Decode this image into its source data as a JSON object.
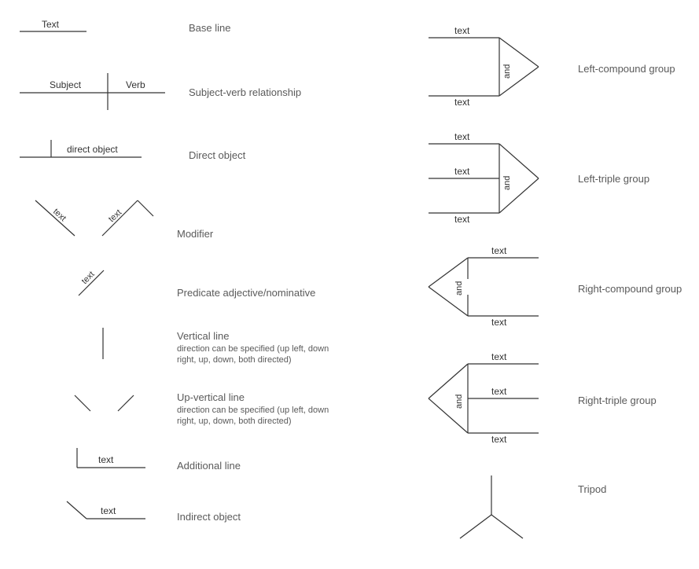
{
  "left": [
    {
      "name": "Base line",
      "svg": "baseline",
      "text1": "Text"
    },
    {
      "name": "Subject-verb relationship",
      "svg": "subjectverb",
      "text1": "Subject",
      "text2": "Verb"
    },
    {
      "name": "Direct object",
      "svg": "directobject",
      "text1": "direct object"
    },
    {
      "name": "Modifier",
      "svg": "modifier",
      "text1": "text",
      "text2": "text"
    },
    {
      "name": "Predicate adjective/nominative",
      "svg": "predicate",
      "text1": "text"
    },
    {
      "name": "Vertical line",
      "sub": "direction can be specified (up left, down right, up, down, both directed)",
      "svg": "vertical"
    },
    {
      "name": "Up-vertical line",
      "sub": "direction can be specified (up left, down right, up, down, both directed)",
      "svg": "upvertical"
    },
    {
      "name": "Additional line",
      "svg": "additional",
      "text1": "text"
    },
    {
      "name": "Indirect object",
      "svg": "indirect",
      "text1": "text"
    }
  ],
  "right": [
    {
      "name": "Left-compound group",
      "svg": "leftcompound",
      "text1": "text",
      "text2": "text",
      "conj": "and"
    },
    {
      "name": "Left-triple group",
      "svg": "lefttriple",
      "text1": "text",
      "text2": "text",
      "text3": "text",
      "conj": "and"
    },
    {
      "name": "Right-compound group",
      "svg": "rightcompound",
      "text1": "text",
      "text2": "text",
      "conj": "and"
    },
    {
      "name": "Right-triple group",
      "svg": "righttriple",
      "text1": "text",
      "text2": "text",
      "text3": "text",
      "conj": "and"
    },
    {
      "name": "Tripod",
      "svg": "tripod"
    }
  ]
}
